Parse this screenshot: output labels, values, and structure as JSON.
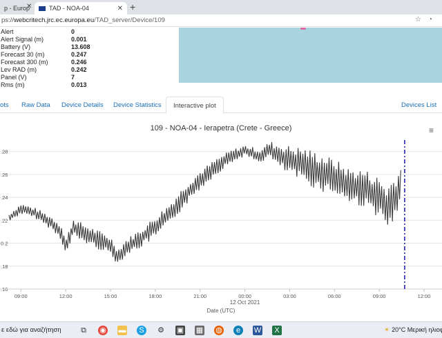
{
  "browser": {
    "tab1_title": "p - Europ",
    "tab2_title": "TAD - NOA-04",
    "url_scheme": "ps://",
    "url_host": "webcritech.jrc.ec.europa.eu",
    "url_path": "/TAD_server/Device/109"
  },
  "device_fields": [
    {
      "label": "Alert",
      "value": "0"
    },
    {
      "label": "Alert Signal (m)",
      "value": "0.001"
    },
    {
      "label": "Battery (V)",
      "value": "13.608"
    },
    {
      "label": "Forecast 30 (m)",
      "value": "0.247"
    },
    {
      "label": "Forecast 300 (m)",
      "value": "0.246"
    },
    {
      "label": "Lev RAD (m)",
      "value": "0.242"
    },
    {
      "label": "Panel (V)",
      "value": "7"
    },
    {
      "label": "Rms (m)",
      "value": "0.013"
    }
  ],
  "nav_tabs": {
    "plots": "ots",
    "raw_data": "Raw Data",
    "device_details": "Device Details",
    "device_statistics": "Device Statistics",
    "interactive_plot": "Interactive plot",
    "devices_list": "Devices List"
  },
  "chart_data": {
    "type": "line",
    "title": "109 - NOA-04 - Ierapetra (Crete - Greece)",
    "xlabel": "Date (UTC)",
    "ylabel": "",
    "date_label": "12 Oct 2021",
    "x_ticks": [
      "09:00",
      "12:00",
      "15:00",
      "18:00",
      "21:00",
      "00:00",
      "03:00",
      "06:00",
      "09:00",
      "12:00"
    ],
    "y_ticks": [
      "0.28",
      "0.26",
      "0.24",
      "0.22",
      "0.2",
      "0.18",
      "0.16"
    ],
    "y_tick_labels_shown": [
      ".28",
      ".26",
      ".24",
      ".22",
      "0.2",
      ".18",
      ".16"
    ],
    "ylim": [
      0.16,
      0.29
    ],
    "xlim_hours": [
      -16.4,
      13.2
    ],
    "grid": true,
    "line_color": "#3a3a3a",
    "marker_color": "#2222aa",
    "current_time_hours": 10.7,
    "series": [
      {
        "x_hours": [
          -15.8,
          -15,
          -14,
          -13,
          -12.3,
          -12,
          -11.5,
          -11,
          -10,
          -9,
          -8.5,
          -8,
          -7,
          -6,
          -5,
          -4,
          -3,
          -2,
          -1,
          0,
          0.5,
          1,
          1.7,
          2,
          3,
          4,
          5,
          6,
          7,
          8,
          9,
          9.5,
          10,
          10.5
        ],
        "values": [
          0.222,
          0.23,
          0.226,
          0.218,
          0.21,
          0.196,
          0.214,
          0.21,
          0.204,
          0.198,
          0.188,
          0.196,
          0.204,
          0.214,
          0.226,
          0.242,
          0.255,
          0.266,
          0.275,
          0.281,
          0.278,
          0.276,
          0.282,
          0.278,
          0.272,
          0.268,
          0.262,
          0.258,
          0.25,
          0.248,
          0.24,
          0.23,
          0.238,
          0.25
        ],
        "amplitude": [
          0.003,
          0.004,
          0.004,
          0.005,
          0.006,
          0.006,
          0.007,
          0.007,
          0.007,
          0.007,
          0.006,
          0.006,
          0.007,
          0.008,
          0.008,
          0.008,
          0.007,
          0.006,
          0.005,
          0.004,
          0.005,
          0.005,
          0.006,
          0.008,
          0.011,
          0.013,
          0.014,
          0.013,
          0.013,
          0.014,
          0.015,
          0.017,
          0.018,
          0.016
        ]
      }
    ]
  },
  "taskbar": {
    "search_text": "ε εδώ για αναζήτηση",
    "weather_text": "20°C  Μερική ηλιοφ"
  },
  "colors": {
    "link_blue": "#1a6fb8",
    "map_water": "#a9d3df",
    "marker_line": "#2222aa"
  }
}
